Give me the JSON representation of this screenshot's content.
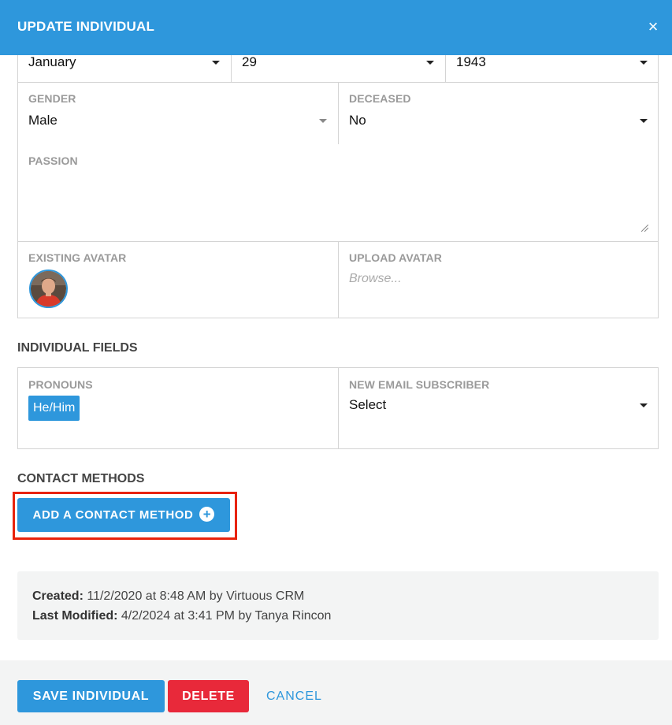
{
  "header": {
    "title": "UPDATE INDIVIDUAL",
    "close_symbol": "×"
  },
  "birthdate": {
    "month": "January",
    "day": "29",
    "year": "1943"
  },
  "gender": {
    "label": "GENDER",
    "value": "Male"
  },
  "deceased": {
    "label": "DECEASED",
    "value": "No"
  },
  "passion": {
    "label": "PASSION",
    "value": ""
  },
  "existing_avatar": {
    "label": "EXISTING AVATAR"
  },
  "upload_avatar": {
    "label": "UPLOAD AVATAR",
    "placeholder": "Browse..."
  },
  "individual_fields": {
    "title": "INDIVIDUAL FIELDS",
    "pronouns": {
      "label": "PRONOUNS",
      "tag": "He/Him"
    },
    "new_email_subscriber": {
      "label": "NEW EMAIL SUBSCRIBER",
      "value": "Select"
    }
  },
  "contact_methods": {
    "title": "CONTACT METHODS",
    "add_button_label": "ADD A CONTACT METHOD"
  },
  "audit": {
    "created_label": "Created:",
    "created_value": "11/2/2020 at 8:48 AM by Virtuous CRM",
    "modified_label": "Last Modified:",
    "modified_value": "4/2/2024 at 3:41 PM by Tanya Rincon"
  },
  "footer": {
    "save_label": "SAVE INDIVIDUAL",
    "delete_label": "DELETE",
    "cancel_label": "CANCEL"
  },
  "icons": {
    "close": "close-icon",
    "caret": "caret-down-icon",
    "plus": "plus-circle-icon"
  },
  "colors": {
    "primary": "#2e97dc",
    "danger": "#e8293a",
    "highlight": "#e8230c"
  }
}
